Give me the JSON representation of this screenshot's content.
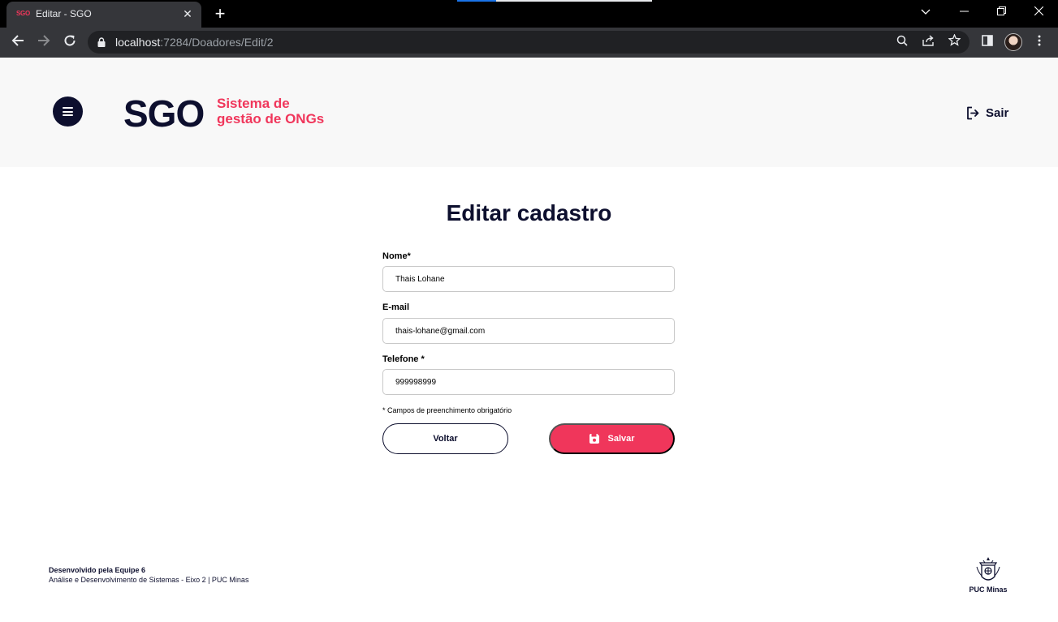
{
  "browser": {
    "tab_favicon_text": "SGO",
    "tab_title": "Editar - SGO",
    "url_host": "localhost",
    "url_path": ":7284/Doadores/Edit/2"
  },
  "header": {
    "logo_main": "SGO",
    "logo_sub_line1": "Sistema de",
    "logo_sub_line2": "gestão de ONGs",
    "logout_label": "Sair"
  },
  "form": {
    "title": "Editar cadastro",
    "name_label": "Nome*",
    "name_value": "Thais Lohane",
    "email_label": "E-mail",
    "email_value": "thais-lohane@gmail.com",
    "phone_label": "Telefone *",
    "phone_value": "999998999",
    "required_hint": "* Campos de preenchimento obrigatório",
    "back_label": "Voltar",
    "save_label": "Salvar"
  },
  "footer": {
    "title": "Desenvolvido pela Equipe 6",
    "subtitle": "Análise e Desenvolvimento de Sistemas - Eixo 2 | PUC Minas",
    "logo_text": "PUC Minas"
  },
  "colors": {
    "brand_dark": "#0d0f2e",
    "brand_accent": "#f0365b",
    "header_bg": "#f8f8f8"
  }
}
